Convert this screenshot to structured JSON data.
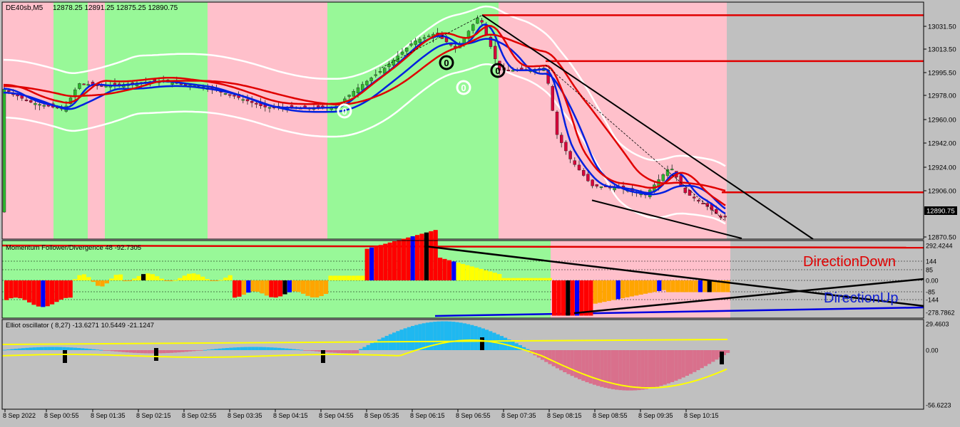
{
  "main_panel": {
    "symbol_label": "DE40sb,M5",
    "ohlc": "12878.25 12891.25 12875.25 12890.75",
    "current_price": "12890.75",
    "price_axis": [
      "13031.50",
      "13013.50",
      "12995.50",
      "12978.00",
      "12960.00",
      "12942.00",
      "12924.00",
      "12906.00",
      "12870.50"
    ],
    "marker_text": "0",
    "colors": {
      "bull_zone": "#98f898",
      "bear_zone": "#ffc0cb",
      "background": "#c0c0c0",
      "ma_red": "#e00000",
      "ma_blue": "#0020e0",
      "band": "#ffffff",
      "bull_candle": "#2eb82e",
      "bear_candle": "#d6003a"
    }
  },
  "momentum_panel": {
    "title": "Momentum Follower/Divergence 48 -92.7305",
    "axis": [
      "292.4244",
      "144",
      "85",
      "0.00",
      "-85",
      "-144",
      "-278.7862"
    ],
    "direction_down_label": "DirectionDown",
    "direction_up_label": "DirectionUp",
    "colors": {
      "down_text": "#e00000",
      "up_text": "#1020d0",
      "bar_red": "#ff0000",
      "bar_blue": "#0000ff",
      "bar_orange": "#ffa500",
      "bar_yellow": "#ffff00",
      "bar_black": "#000000"
    }
  },
  "elliot_panel": {
    "title": "Elliot oscillator ( 8,27) -13.6271 10.5449 -21.1247",
    "axis": [
      "29.4603",
      "0.00",
      "-56.6223"
    ],
    "colors": {
      "positive": "#1fb8f0",
      "negative": "#d9708c",
      "signal": "#ffff00"
    }
  },
  "time_axis": [
    "8 Sep 2022",
    "8 Sep 00:55",
    "8 Sep 01:35",
    "8 Sep 02:15",
    "8 Sep 02:55",
    "8 Sep 03:35",
    "8 Sep 04:15",
    "8 Sep 04:55",
    "8 Sep 05:35",
    "8 Sep 06:15",
    "8 Sep 06:55",
    "8 Sep 07:35",
    "8 Sep 08:15",
    "8 Sep 08:55",
    "8 Sep 09:35",
    "8 Sep 10:15"
  ]
}
